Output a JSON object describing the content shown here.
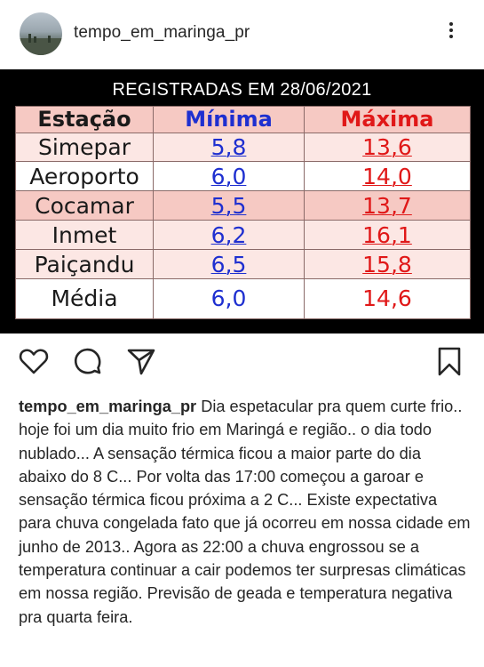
{
  "header": {
    "username": "tempo_em_maringa_pr"
  },
  "post": {
    "title": "REGISTRADAS EM 28/06/2021",
    "columns": [
      "Estação",
      "Mínima",
      "Máxima"
    ],
    "rows": [
      {
        "station": "Simepar",
        "min": "5,8",
        "max": "13,6"
      },
      {
        "station": "Aeroporto",
        "min": "6,0",
        "max": "14,0"
      },
      {
        "station": "Cocamar",
        "min": "5,5",
        "max": "13,7"
      },
      {
        "station": "Inmet",
        "min": "6,2",
        "max": "16,1"
      },
      {
        "station": "Paiçandu",
        "min": "6,5",
        "max": "15,8"
      },
      {
        "station": "Média",
        "min": "6,0",
        "max": "14,6"
      }
    ]
  },
  "actions": {
    "like_icon": "heart-icon",
    "comment_icon": "comment-icon",
    "share_icon": "paper-plane-icon",
    "save_icon": "bookmark-icon"
  },
  "caption": {
    "username": "tempo_em_maringa_pr",
    "text": "Dia espetacular pra quem curte frio.. hoje foi um dia muito frio em Maringá e região.. o dia todo nublado... A sensação térmica ficou a maior parte do dia abaixo do 8 C... Por volta das 17:00 começou a garoar e sensação térmica ficou próxima a 2 C... Existe expectativa para chuva congelada fato que já ocorreu em nossa cidade em junho de 2013.. Agora as 22:00 a chuva engrossou se a temperatura continuar a cair podemos ter surpresas climáticas em nossa região. Previsão de geada e temperatura negativa pra quarta feira."
  },
  "colors": {
    "min_color": "#1e2fd0",
    "max_color": "#e01818",
    "row_pink": "#f6c9c3"
  }
}
